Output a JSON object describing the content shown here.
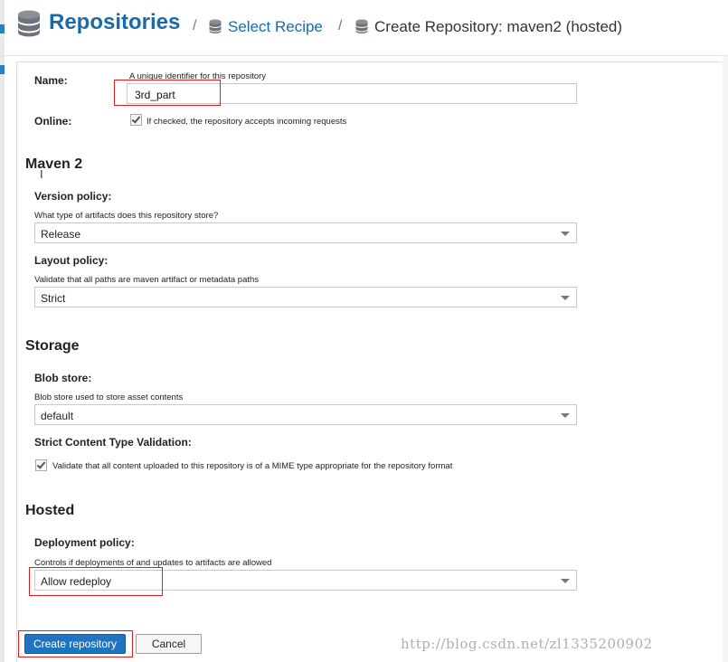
{
  "header": {
    "title": "Repositories",
    "separator": "/",
    "select_recipe": "Select Recipe",
    "current": "Create Repository: maven2 (hosted)"
  },
  "form": {
    "name": {
      "label": "Name:",
      "help": "A unique identifier for this repository",
      "value": "3rd_part"
    },
    "online": {
      "label": "Online:",
      "checked": true,
      "text": "If checked, the repository accepts incoming requests"
    },
    "maven": {
      "section_title": "Maven 2",
      "version_policy": {
        "label": "Version policy:",
        "help": "What type of artifacts does this repository store?",
        "value": "Release"
      },
      "layout_policy": {
        "label": "Layout policy:",
        "help": "Validate that all paths are maven artifact or metadata paths",
        "value": "Strict"
      }
    },
    "storage": {
      "section_title": "Storage",
      "blob_store": {
        "label": "Blob store:",
        "help": "Blob store used to store asset contents",
        "value": "default"
      },
      "strict_validation": {
        "label": "Strict Content Type Validation:",
        "checked": true,
        "text": "Validate that all content uploaded to this repository is of a MIME type appropriate for the repository format"
      }
    },
    "hosted": {
      "section_title": "Hosted",
      "deployment_policy": {
        "label": "Deployment policy:",
        "help": "Controls if deployments of and updates to artifacts are allowed",
        "value": "Allow redeploy"
      }
    }
  },
  "actions": {
    "create": "Create repository",
    "cancel": "Cancel"
  },
  "watermark": "http://blog.csdn.net/zl1335200902",
  "colors": {
    "accent": "#1b6aa8",
    "primary_button": "#1f74c2",
    "highlight": "#e01b1b"
  },
  "icons": {
    "repositories": "database-icon",
    "select_recipe": "database-icon",
    "current": "database-icon"
  }
}
